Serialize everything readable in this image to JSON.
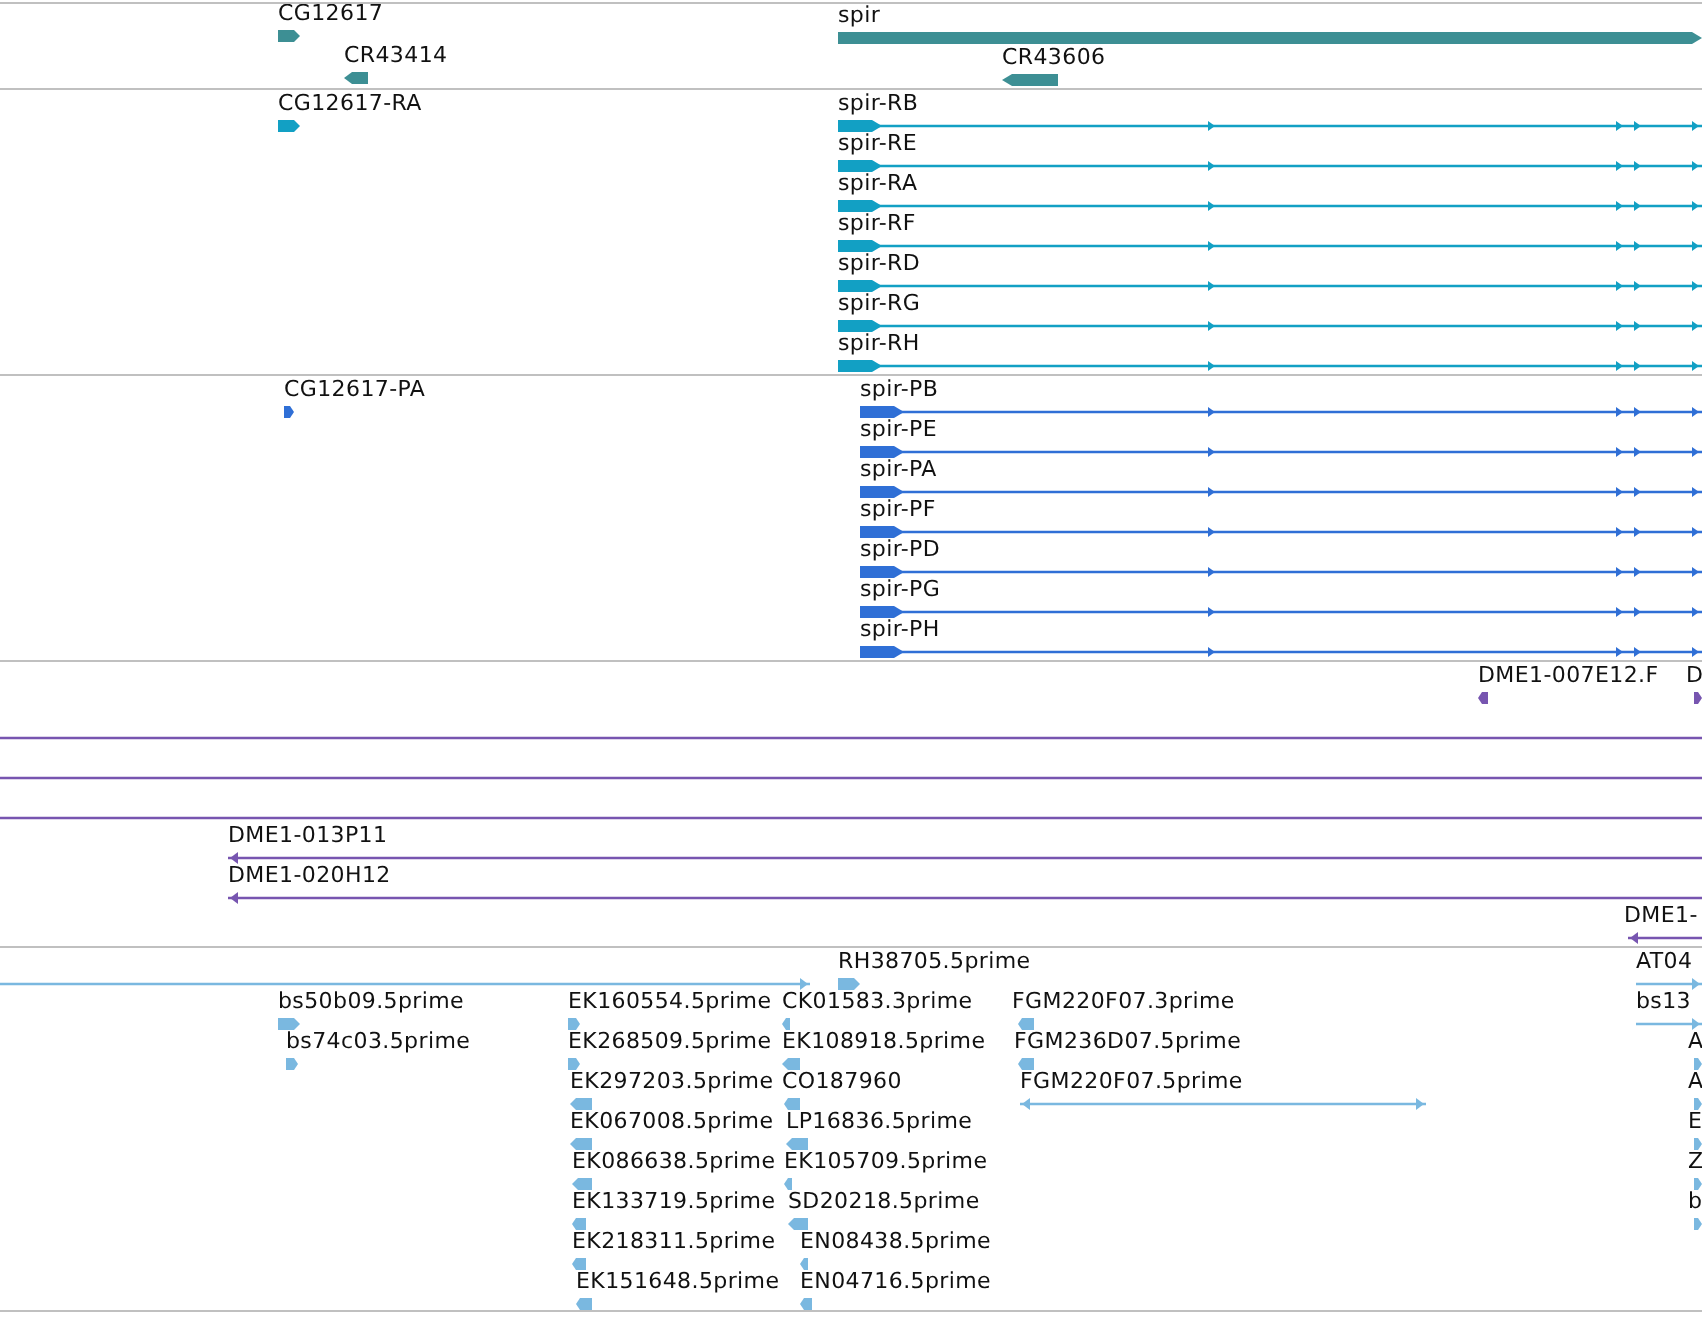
{
  "tracks": [
    {
      "color": "#3d8f94",
      "features": [
        {
          "label": "CG12617",
          "kind": "gene",
          "reverse": false
        },
        {
          "label": "CR43414",
          "kind": "gene",
          "reverse": true
        },
        {
          "label": "spir",
          "kind": "gene",
          "reverse": false
        },
        {
          "label": "CR43606",
          "kind": "gene",
          "reverse": true
        }
      ]
    },
    {
      "color": "#12a0c4",
      "features": [
        {
          "label": "CG12617-RA",
          "kind": "gene",
          "reverse": false
        },
        {
          "label": "spir-RB",
          "kind": "transcript",
          "reverse": false
        },
        {
          "label": "spir-RE",
          "kind": "transcript",
          "reverse": false
        },
        {
          "label": "spir-RA",
          "kind": "transcript",
          "reverse": false
        },
        {
          "label": "spir-RF",
          "kind": "transcript",
          "reverse": false
        },
        {
          "label": "spir-RD",
          "kind": "transcript",
          "reverse": false
        },
        {
          "label": "spir-RG",
          "kind": "transcript",
          "reverse": false
        },
        {
          "label": "spir-RH",
          "kind": "transcript",
          "reverse": false
        }
      ]
    },
    {
      "color": "#2f6fd6",
      "features": [
        {
          "label": "CG12617-PA",
          "kind": "gene",
          "reverse": false
        },
        {
          "label": "spir-PB",
          "kind": "transcript",
          "reverse": false
        },
        {
          "label": "spir-PE",
          "kind": "transcript",
          "reverse": false
        },
        {
          "label": "spir-PA",
          "kind": "transcript",
          "reverse": false
        },
        {
          "label": "spir-PF",
          "kind": "transcript",
          "reverse": false
        },
        {
          "label": "spir-PD",
          "kind": "transcript",
          "reverse": false
        },
        {
          "label": "spir-PG",
          "kind": "transcript",
          "reverse": false
        },
        {
          "label": "spir-PH",
          "kind": "transcript",
          "reverse": false
        }
      ]
    },
    {
      "color": "#7755b0",
      "features": [
        {
          "label": "DME1-007E12.F",
          "kind": "gene",
          "reverse": true
        },
        {
          "label": "D",
          "kind": "gene",
          "reverse": false
        },
        {
          "kind": "line"
        },
        {
          "kind": "line"
        },
        {
          "kind": "line"
        },
        {
          "label": "DME1-013P11",
          "kind": "read",
          "reverse": true
        },
        {
          "label": "DME1-020H12",
          "kind": "read",
          "reverse": true
        },
        {
          "label": "DME1-",
          "kind": "read",
          "reverse": true
        }
      ]
    },
    {
      "color": "#7ab8e0",
      "features": [
        {
          "kind": "read",
          "reverse": false
        },
        {
          "label": "RH38705.5prime",
          "kind": "gene",
          "reverse": false
        },
        {
          "label": "AT04",
          "kind": "read",
          "reverse": false
        },
        {
          "label": "bs50b09.5prime",
          "kind": "gene",
          "reverse": false
        },
        {
          "label": "EK160554.5prime",
          "kind": "gene",
          "reverse": false
        },
        {
          "label": "CK01583.3prime",
          "kind": "gene",
          "reverse": true
        },
        {
          "label": "FGM220F07.3prime",
          "kind": "gene",
          "reverse": true
        },
        {
          "label": "bs13",
          "kind": "read",
          "reverse": false
        },
        {
          "label": "bs74c03.5prime",
          "kind": "gene",
          "reverse": false
        },
        {
          "label": "EK268509.5prime",
          "kind": "gene",
          "reverse": false
        },
        {
          "label": "EK108918.5prime",
          "kind": "gene",
          "reverse": true
        },
        {
          "label": "FGM236D07.5prime",
          "kind": "gene",
          "reverse": true
        },
        {
          "label": "A",
          "kind": "gene",
          "reverse": false
        },
        {
          "label": "EK297203.5prime",
          "kind": "gene",
          "reverse": true
        },
        {
          "label": "CO187960",
          "kind": "gene",
          "reverse": true
        },
        {
          "label": "FGM220F07.5prime",
          "kind": "read",
          "reverse": true
        },
        {
          "label": "A",
          "kind": "gene",
          "reverse": false
        },
        {
          "label": "EK067008.5prime",
          "kind": "gene",
          "reverse": true
        },
        {
          "label": "LP16836.5prime",
          "kind": "gene",
          "reverse": true
        },
        {
          "label": "E",
          "kind": "gene",
          "reverse": false
        },
        {
          "label": "EK086638.5prime",
          "kind": "gene",
          "reverse": true
        },
        {
          "label": "EK105709.5prime",
          "kind": "gene",
          "reverse": true
        },
        {
          "label": "Z",
          "kind": "gene",
          "reverse": false
        },
        {
          "label": "EK133719.5prime",
          "kind": "gene",
          "reverse": true
        },
        {
          "label": "SD20218.5prime",
          "kind": "gene",
          "reverse": true
        },
        {
          "label": "b",
          "kind": "gene",
          "reverse": false
        },
        {
          "label": "EK218311.5prime",
          "kind": "gene",
          "reverse": true
        },
        {
          "label": "EN08438.5prime",
          "kind": "gene",
          "reverse": true
        },
        {
          "label": "EK151648.5prime",
          "kind": "gene",
          "reverse": true
        },
        {
          "label": "EN04716.5prime",
          "kind": "gene",
          "reverse": true
        }
      ]
    }
  ]
}
